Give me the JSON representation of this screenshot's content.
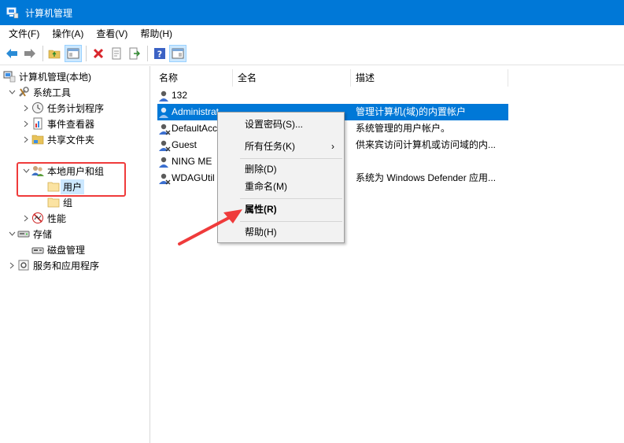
{
  "window": {
    "title": "计算机管理"
  },
  "menu": [
    "文件(F)",
    "操作(A)",
    "查看(V)",
    "帮助(H)"
  ],
  "tree": {
    "root": "计算机管理(本地)",
    "system_tools": "系统工具",
    "task_scheduler": "任务计划程序",
    "event_viewer": "事件查看器",
    "shared_folders": "共享文件夹",
    "local_users_groups": "本地用户和组",
    "users": "用户",
    "groups": "组",
    "performance": "性能",
    "storage": "存储",
    "disk_management": "磁盘管理",
    "services_apps": "服务和应用程序"
  },
  "columns": [
    "名称",
    "全名",
    "描述"
  ],
  "rows": [
    {
      "name": "132",
      "full": "",
      "desc": ""
    },
    {
      "name": "Administrat",
      "full": "",
      "desc": "管理计算机(域)的内置帐户"
    },
    {
      "name": "DefaultAcc",
      "full": "",
      "desc": "系统管理的用户帐户。"
    },
    {
      "name": "Guest",
      "full": "",
      "desc": "供来宾访问计算机或访问域的内..."
    },
    {
      "name": "NING ME",
      "full": "",
      "desc": ""
    },
    {
      "name": "WDAGUtil",
      "full": "",
      "desc": "系统为 Windows Defender 应用..."
    }
  ],
  "context_menu": {
    "set_password": "设置密码(S)...",
    "all_tasks": "所有任务(K)",
    "all_tasks_arrow": "›",
    "delete": "删除(D)",
    "rename": "重命名(M)",
    "properties": "属性(R)",
    "help": "帮助(H)"
  },
  "colors": {
    "titlebar": "#0078d7",
    "selection": "#0078d7",
    "tree_selection": "#cce8ff",
    "annotation": "#ef3b3b"
  }
}
